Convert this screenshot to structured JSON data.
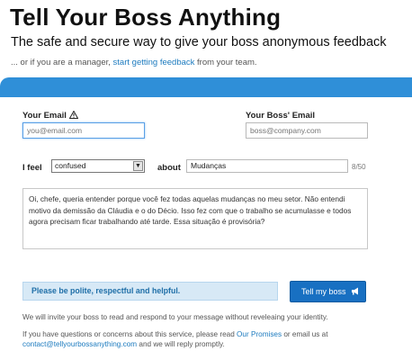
{
  "header": {
    "title": "Tell Your Boss Anything",
    "subtitle": "The safe and secure way to give your boss anonymous feedback",
    "manager_prefix": "... or if you are a manager, ",
    "manager_link": "start getting feedback",
    "manager_suffix": " from your team."
  },
  "form": {
    "your_email_label": "Your Email",
    "your_email_placeholder": "you@email.com",
    "boss_email_label": "Your Boss' Email",
    "boss_email_placeholder": "boss@company.com",
    "i_feel_label": "I feel",
    "feeling_selected": "confused",
    "about_label": "about",
    "about_value": "Mudanças",
    "about_counter": "8/50",
    "message": "Oi, chefe, queria entender porque você fez todas aquelas mudanças no meu setor. Não entendi motivo da demissão da Cláudia e o do Décio. Isso fez com que o trabalho se acumulasse e todos agora precisam ficar trabalhando até tarde. Essa situação é provisória?",
    "notice": "Please be polite, respectful and helpful.",
    "send_button": "Tell my boss"
  },
  "footer": {
    "invite_text": "We will invite your boss to read and respond to your message without reveleaing your identity.",
    "questions_prefix": "If you have questions or concerns about this service, please read ",
    "promises_link": "Our Promises",
    "questions_suffix": " or email us at",
    "contact_email": "contact@tellyourbossanything.com",
    "contact_suffix": " and we will reply promptly."
  },
  "icons": {
    "warning": "warning-icon",
    "send": "megaphone-icon",
    "dropdown": "chevron-down-icon"
  },
  "colors": {
    "accent_blue": "#2f8fd8",
    "link_blue": "#1d7bbf",
    "button_blue": "#1870c2",
    "notice_bg": "#d7e9f6"
  }
}
